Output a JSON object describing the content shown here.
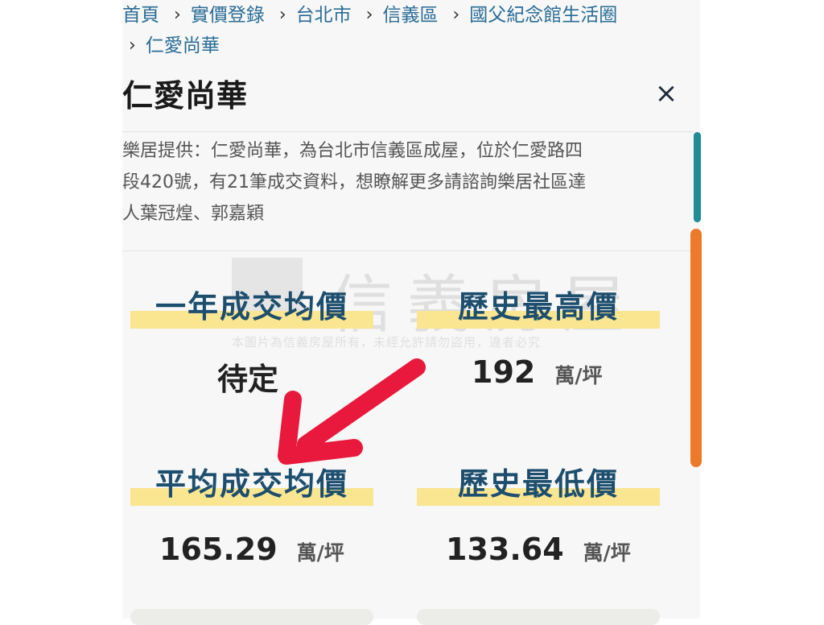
{
  "breadcrumb": {
    "row1": [
      "首頁",
      "實價登錄",
      "台北市",
      "信義區",
      "國父紀念館生活圈"
    ],
    "row2": [
      "仁愛尚華"
    ],
    "separator": "›"
  },
  "header": {
    "title": "仁愛尚華",
    "close": "×"
  },
  "description": {
    "line1": "樂居提供：仁愛尚華，為台北市信義區成屋，位於仁愛路四",
    "line2": "段420號，有21筆成交資料，想瞭解更多請諮詢樂居社區達",
    "line3": "人葉冠煌、郭嘉穎"
  },
  "stats": {
    "one_year": {
      "label": "一年成交均價",
      "value": "待定"
    },
    "hist_high": {
      "label": "歷史最高價",
      "value": "192",
      "unit": "萬/坪"
    },
    "average": {
      "label": "平均成交均價",
      "value": "165.29",
      "unit": "萬/坪"
    },
    "hist_low": {
      "label": "歷史最低價",
      "value": "133.64",
      "unit": "萬/坪"
    }
  },
  "watermark": {
    "text": "信義房屋",
    "sub": "本圖片為信義房屋所有，未經允許請勿盜用，違者必究"
  },
  "colors": {
    "link": "#2a6c96",
    "label": "#1d4e6e",
    "highlight": "#fae590",
    "scroll_teal": "#1f8c96",
    "scroll_orange": "#ed7a2b",
    "arrow": "#e8193c"
  },
  "icons": {
    "close": "close-icon",
    "chevron": "chevron-right-icon",
    "arrow": "red-arrow-annotation"
  }
}
